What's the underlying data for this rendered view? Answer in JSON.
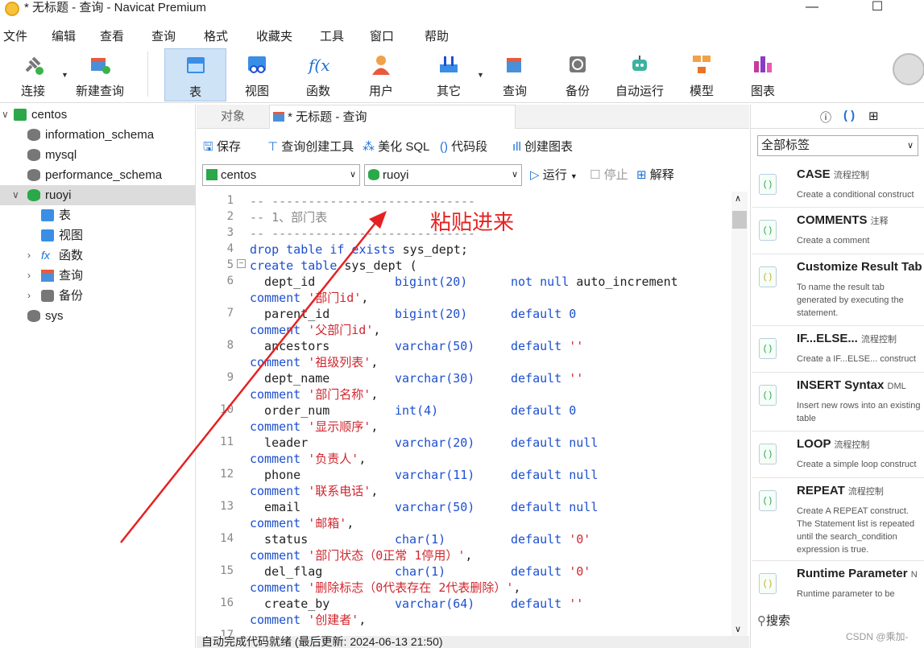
{
  "window": {
    "title": "* 无标题 - 查询 - Navicat Premium",
    "minimize": "—",
    "maximize": "☐",
    "close": "✕"
  },
  "menu": [
    "文件",
    "编辑",
    "查看",
    "查询",
    "格式",
    "收藏夹",
    "工具",
    "窗口",
    "帮助"
  ],
  "toolbar": {
    "connect": "连接",
    "new_query": "新建查询",
    "table": "表",
    "view": "视图",
    "function": "函数",
    "user": "用户",
    "other": "其它",
    "query": "查询",
    "backup": "备份",
    "auto_run": "自动运行",
    "model": "模型",
    "chart": "图表"
  },
  "tree": [
    {
      "label": "centos",
      "type": "conn"
    },
    {
      "label": "information_schema",
      "type": "db"
    },
    {
      "label": "mysql",
      "type": "db"
    },
    {
      "label": "performance_schema",
      "type": "db"
    },
    {
      "label": "ruoyi",
      "type": "db-open"
    },
    {
      "label": "表",
      "type": "table"
    },
    {
      "label": "视图",
      "type": "view"
    },
    {
      "label": "函数",
      "type": "func"
    },
    {
      "label": "查询",
      "type": "query"
    },
    {
      "label": "备份",
      "type": "backup"
    },
    {
      "label": "sys",
      "type": "db"
    }
  ],
  "tabs": {
    "objects": "对象",
    "query_tab": "* 无标题 - 查询"
  },
  "subbar": {
    "save": "保存",
    "builder": "查询创建工具",
    "beautify": "美化 SQL",
    "snippet": "代码段",
    "create_chart": "创建图表"
  },
  "connbar": {
    "connection": "centos",
    "database": "ruoyi",
    "run": "运行",
    "stop": "停止",
    "explain": "解释"
  },
  "line_numbers": [
    "1",
    "2",
    "3",
    "4",
    "5",
    "6",
    "7",
    "8",
    "9",
    "10",
    "11",
    "12",
    "13",
    "14",
    "15",
    "16",
    "17"
  ],
  "code": {
    "l1": "-- ----------------------------",
    "l2": "-- 1、部门表",
    "l3": "-- ----------------------------",
    "l4_kw": "drop table if exists",
    "l4_id": " sys_dept;",
    "l5_kw": "create table",
    "l5_id": " sys_dept (",
    "c1_name": "  dept_id",
    "c1_type": "bigint(20)",
    "c1_kw": "not null",
    "c1_extra": " auto_increment",
    "c1_cm": "'部门id'",
    "c2_name": "  parent_id",
    "c2_type": "bigint(20)",
    "c2_kw": "default",
    "c2_def": " 0",
    "c2_cm": "'父部门id'",
    "c3_name": "  ancestors",
    "c3_type": "varchar(50)",
    "c3_kw": "default",
    "c3_def": " ''",
    "c3_cm": "'祖级列表'",
    "c4_name": "  dept_name",
    "c4_type": "varchar(30)",
    "c4_kw": "default",
    "c4_def": " ''",
    "c4_cm": "'部门名称'",
    "c5_name": "  order_num",
    "c5_type": "int(4)",
    "c5_kw": "default",
    "c5_def": " 0",
    "c5_cm": "'显示顺序'",
    "c6_name": "  leader",
    "c6_type": "varchar(20)",
    "c6_kw": "default null",
    "c6_cm": "'负责人'",
    "c7_name": "  phone",
    "c7_type": "varchar(11)",
    "c7_kw": "default null",
    "c7_cm": "'联系电话'",
    "c8_name": "  email",
    "c8_type": "varchar(50)",
    "c8_kw": "default null",
    "c8_cm": "'邮箱'",
    "c9_name": "  status",
    "c9_type": "char(1)",
    "c9_kw": "default",
    "c9_def": " '0'",
    "c9_cm": "'部门状态（0正常 1停用）'",
    "c10_name": "  del_flag",
    "c10_type": "char(1)",
    "c10_kw": "default",
    "c10_def": " '0'",
    "c10_cm": "'删除标志（0代表存在 2代表删除）'",
    "c11_name": "  create_by",
    "c11_type": "varchar(64)",
    "c11_kw": "default",
    "c11_def": " ''",
    "c11_cm": "'创建者'",
    "comment_kw": "comment",
    "comma": ","
  },
  "annotation": "粘贴进来",
  "status": "自动完成代码就绪 (最后更新: 2024-06-13 21:50)",
  "right_panel": {
    "filter": "全部标签",
    "snippets": [
      {
        "title": "CASE",
        "tag": "流程控制",
        "desc": "Create a conditional construct"
      },
      {
        "title": "COMMENTS",
        "tag": "注释",
        "desc": "Create a comment"
      },
      {
        "title": "Customize Result Tab",
        "tag": "",
        "desc": "To name the result tab generated by executing the statement."
      },
      {
        "title": "IF...ELSE...",
        "tag": "流程控制",
        "desc": "Create a IF...ELSE... construct"
      },
      {
        "title": "INSERT Syntax",
        "tag": "DML",
        "desc": "Insert new rows into an existing table"
      },
      {
        "title": "LOOP",
        "tag": "流程控制",
        "desc": "Create a simple loop construct"
      },
      {
        "title": "REPEAT",
        "tag": "流程控制",
        "desc": "Create A REPEAT construct. The Statement list is repeated until the search_condition expression is true."
      },
      {
        "title": "Runtime Parameter",
        "tag": "N",
        "desc": "Runtime parameter to be replaced when the statement is"
      }
    ],
    "search": "搜索"
  },
  "watermark": "CSDN @乘加-",
  "colors": {
    "keyword": "#1c4fd0",
    "string": "#d0272f",
    "comment": "#888888",
    "annotation": "#e52222",
    "active_tool": "#cfe3f6"
  }
}
